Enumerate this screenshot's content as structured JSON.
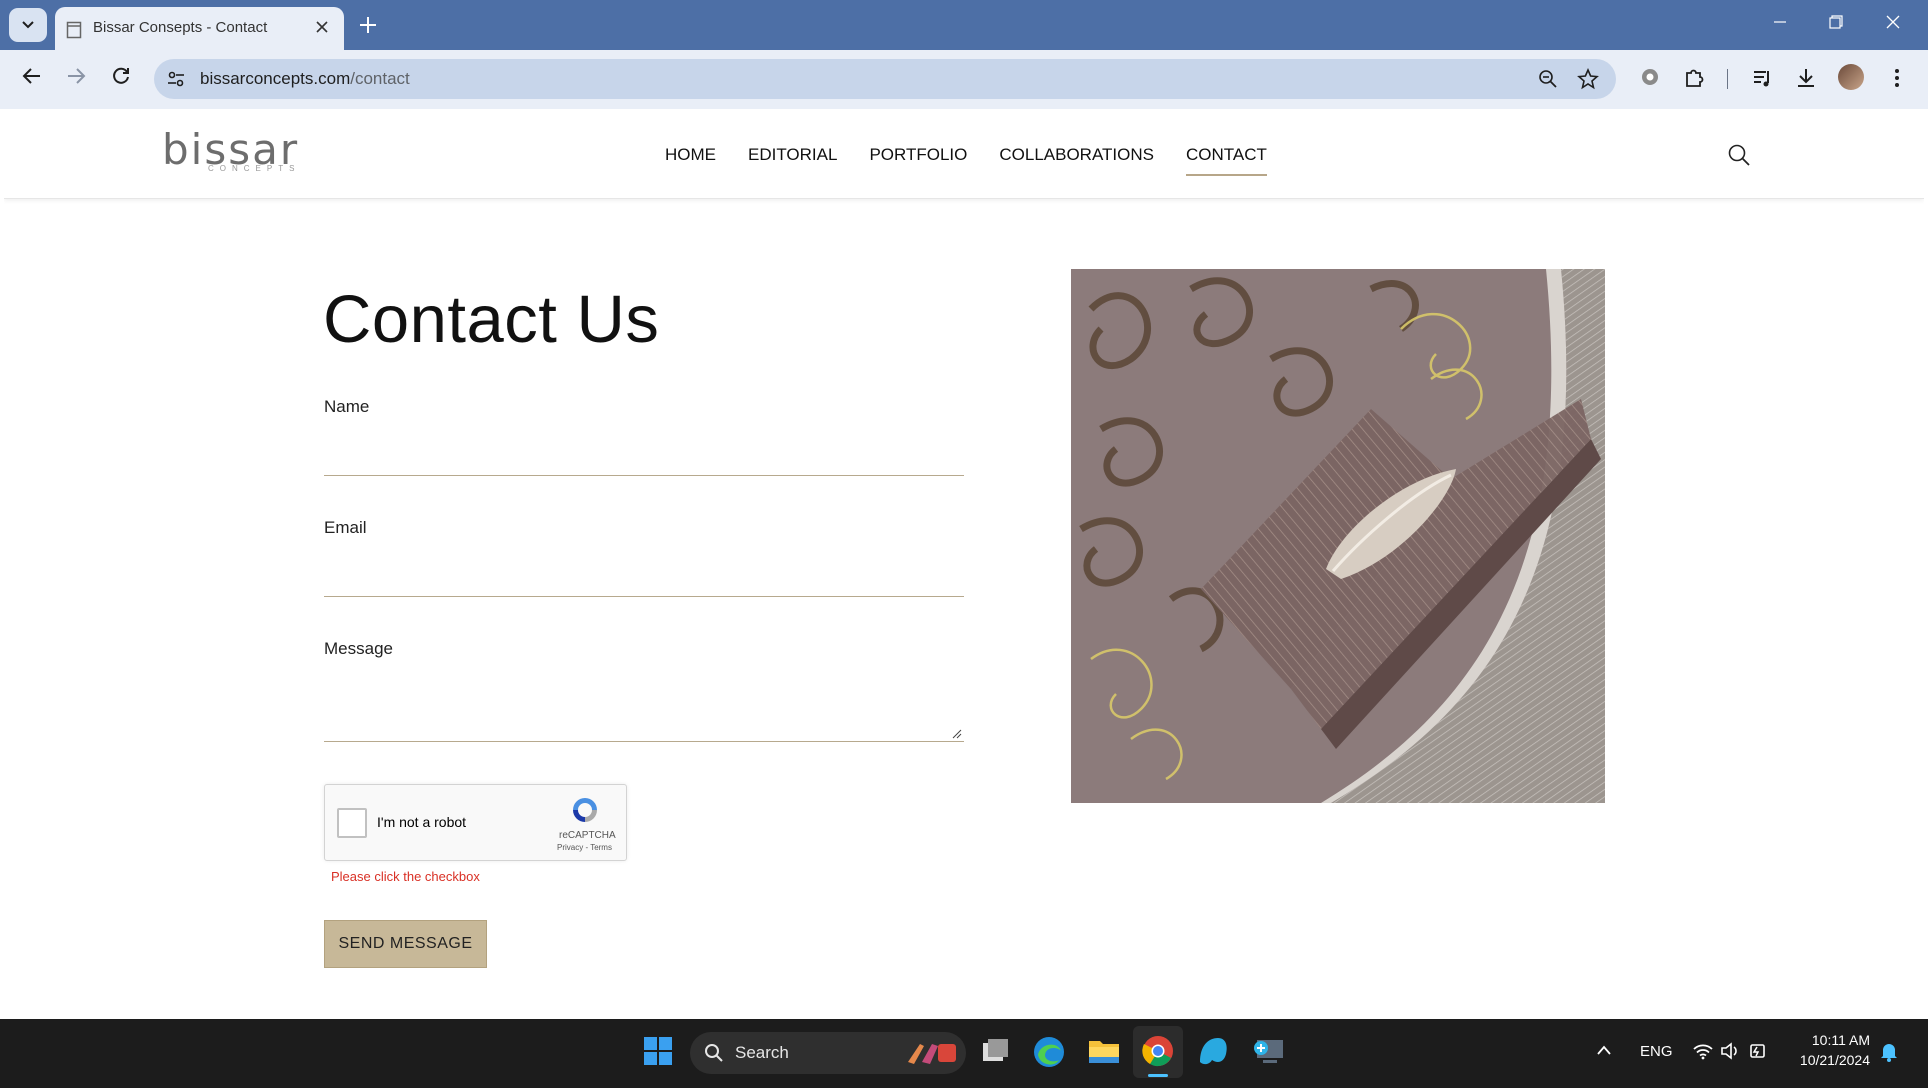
{
  "browser": {
    "tab_title": "Bissar Consepts - Contact",
    "url_domain": "bissarconcepts.com",
    "url_path": "/contact"
  },
  "site": {
    "logo_text": "bissar",
    "logo_sub": "CONCEPTS",
    "nav": [
      {
        "label": "HOME",
        "active": false
      },
      {
        "label": "EDITORIAL",
        "active": false
      },
      {
        "label": "PORTFOLIO",
        "active": false
      },
      {
        "label": "COLLABORATIONS",
        "active": false
      },
      {
        "label": "CONTACT",
        "active": true
      }
    ]
  },
  "contact": {
    "title": "Contact Us",
    "name_label": "Name",
    "email_label": "Email",
    "message_label": "Message",
    "recaptcha": {
      "label": "I'm not a robot",
      "brand": "reCAPTCHA",
      "links": "Privacy - Terms"
    },
    "error": "Please click the checkbox",
    "submit_label": "SEND MESSAGE"
  },
  "taskbar": {
    "search_label": "Search",
    "language": "ENG",
    "time": "10:11 AM",
    "date": "10/21/2024"
  },
  "colors": {
    "chrome_blue": "#4d6fa6",
    "accent_tan": "#c7b898",
    "error_red": "#d93025"
  }
}
